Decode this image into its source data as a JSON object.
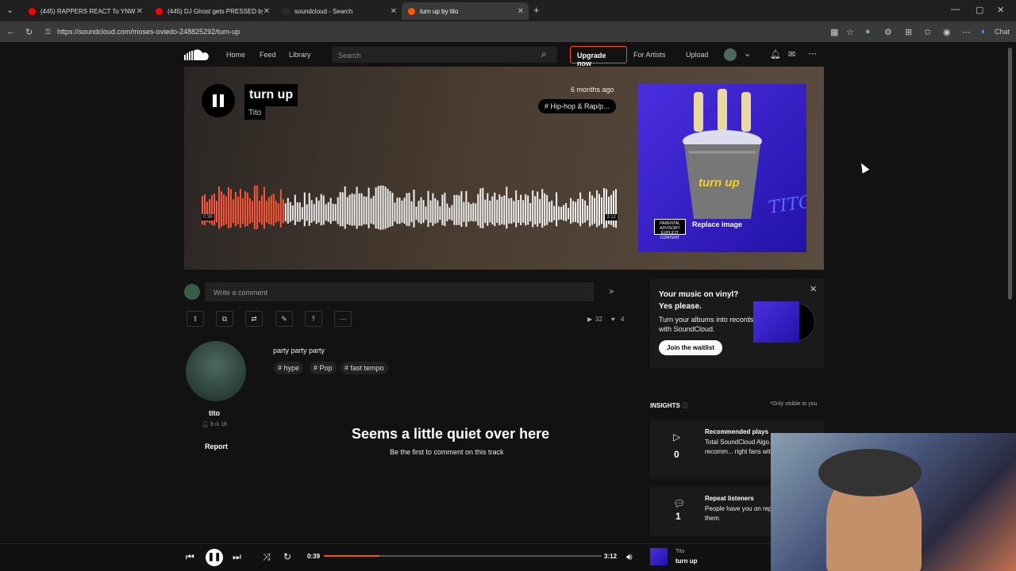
{
  "browser": {
    "tabs": [
      {
        "label": "(445) RAPPERS REACT To YNW M...",
        "icon_color": "#ff0000"
      },
      {
        "label": "(445) DJ Ghost gets PRESSED by a...",
        "icon_color": "#ff0000"
      },
      {
        "label": "soundcloud - Search",
        "icon_color": "#2a2a2a"
      },
      {
        "label": "turn up by tito",
        "icon_color": "#f50"
      }
    ],
    "url": "https://soundcloud.com/moses-oviedo-248825292/turn-up",
    "chat_label": "Chat"
  },
  "nav": {
    "home": "Home",
    "feed": "Feed",
    "library": "Library",
    "search_placeholder": "Search",
    "upgrade": "Upgrade now",
    "for_artists": "For Artists",
    "upload": "Upload"
  },
  "track": {
    "title": "turn up",
    "artist": "Tito",
    "posted": "6 months ago",
    "genre": "# Hip-hop & Rap/p...",
    "elapsed_wave": "0:39",
    "duration_wave": "3:12",
    "progress": 0.2,
    "replace_image": "Replace image",
    "art_text": "turn up",
    "art_signature": "TITO",
    "advisory": "PARENTAL ADVISORY EXPLICIT CONTENT"
  },
  "comments": {
    "placeholder": "Write a comment",
    "empty_title": "Seems a little quiet over here",
    "empty_sub": "Be the first to comment on this track"
  },
  "stats": {
    "plays": "32",
    "likes": "4"
  },
  "user": {
    "name": "tito",
    "followers": "9",
    "tracks": "18",
    "report": "Report"
  },
  "description": "party party party",
  "tags": [
    "# hype",
    "# Pop",
    "# fast tempo"
  ],
  "vinyl": {
    "title": "Your music on vinyl? Yes please.",
    "desc": "Turn your albums into records with SoundCloud.",
    "button": "Join the waitlist"
  },
  "insights": {
    "label": "INSIGHTS",
    "visibility": "*Only visible to you",
    "cards": [
      {
        "title": "Recommended plays",
        "desc": "Total SoundCloud Algo... your next track recomm... right fans with a subscr...",
        "value": "0"
      },
      {
        "title": "Repeat listeners",
        "desc": "People have you on rep... and message them.",
        "value": "1"
      }
    ]
  },
  "player": {
    "elapsed": "0:39",
    "duration": "3:12",
    "progress": 0.2,
    "artist": "Tito",
    "title": "turn up"
  }
}
